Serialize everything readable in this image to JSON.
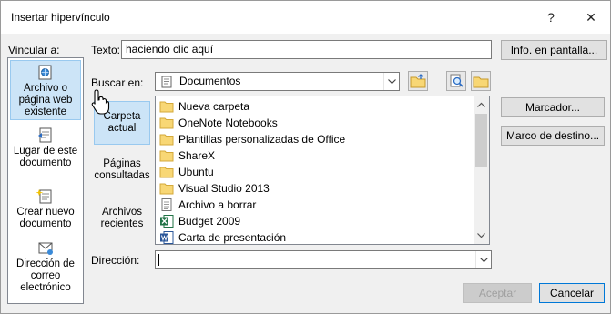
{
  "title": "Insertar hipervínculo",
  "titlebar": {
    "help": "?",
    "close": "✕"
  },
  "link_to": {
    "label": "Vincular a:",
    "items": [
      {
        "line1": "Archivo o",
        "line2": "página web",
        "line3": "existente"
      },
      {
        "line1": "Lugar de este",
        "line2": "documento"
      },
      {
        "line1": "Crear nuevo",
        "line2": "documento"
      },
      {
        "line1": "Dirección de",
        "line2": "correo",
        "line3": "electrónico"
      }
    ]
  },
  "text_field": {
    "label": "Texto:",
    "value": "haciendo clic aquí"
  },
  "screentip_button": "Info. en pantalla...",
  "look_in": {
    "label": "Buscar en:",
    "value": "Documentos"
  },
  "subnav": [
    {
      "line1": "Carpeta",
      "line2": "actual"
    },
    {
      "line1": "Páginas",
      "line2": "consultadas"
    },
    {
      "line1": "Archivos",
      "line2": "recientes"
    }
  ],
  "files": [
    {
      "name": "Nueva carpeta",
      "icon": "folder-icon"
    },
    {
      "name": "OneNote Notebooks",
      "icon": "folder-icon"
    },
    {
      "name": "Plantillas personalizadas de Office",
      "icon": "folder-icon"
    },
    {
      "name": "ShareX",
      "icon": "folder-icon"
    },
    {
      "name": "Ubuntu",
      "icon": "folder-icon"
    },
    {
      "name": "Visual Studio 2013",
      "icon": "folder-icon"
    },
    {
      "name": "Archivo a borrar",
      "icon": "text-file-icon"
    },
    {
      "name": "Budget 2009",
      "icon": "excel-file-icon"
    },
    {
      "name": "Carta de presentación",
      "icon": "word-file-icon"
    }
  ],
  "bookmark_button": "Marcador...",
  "target_frame_button": "Marco de destino...",
  "address": {
    "label": "Dirección:",
    "value": ""
  },
  "ok_button": "Aceptar",
  "cancel_button": "Cancelar",
  "colors": {
    "folder": "#f8d775",
    "selection": "#cce4f7",
    "excel": "#217346",
    "word": "#2b579a"
  }
}
